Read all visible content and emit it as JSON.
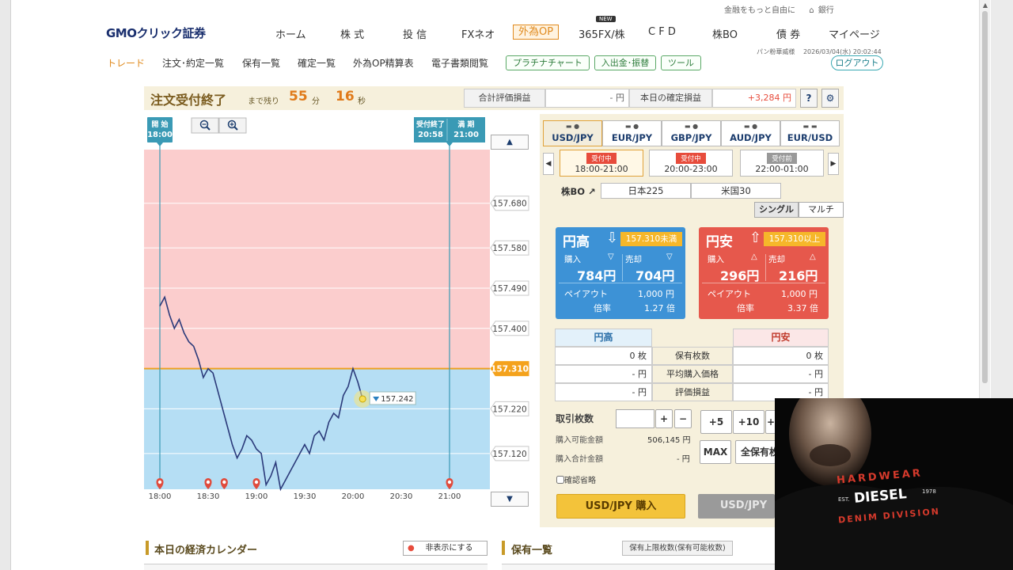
{
  "header": {
    "top_links": [
      "金融をもっと自由に",
      "銀行"
    ],
    "logo_text": "GMOクリック証券",
    "nav": [
      "ホーム",
      "株 式",
      "投 信",
      "FXネオ",
      "外為OP",
      "365FX/株",
      "C F D",
      "株BO",
      "債 券",
      "マイページ"
    ],
    "nav_selected": "外為OP",
    "new_badge": "NEW",
    "user_name": "パン粉華威様",
    "datetime": "2026/03/04(水) 20:02:44",
    "subnav": [
      "トレード",
      "注文･約定一覧",
      "保有一覧",
      "確定一覧",
      "外為OP精算表",
      "電子書類閲覧"
    ],
    "subnav_active": "トレード",
    "tool_buttons": [
      "プラチナチャート",
      "入出金･振替",
      "ツール"
    ],
    "logout": "ログアウト"
  },
  "status": {
    "title": "注文受付終了",
    "remaining_label": "まで残り",
    "minutes": "55",
    "minutes_unit": "分",
    "seconds": "16",
    "seconds_unit": "秒",
    "eval_label": "合計評価損益",
    "eval_value": "- 円",
    "pl_label": "本日の確定損益",
    "pl_value": "+3,284 円",
    "help": "?",
    "settings_icon": "gear-icon"
  },
  "chart": {
    "start_label": "開 始",
    "start_time": "18:00",
    "close_label": "受付終了",
    "close_time": "20:58",
    "expiry_label": "満 期",
    "expiry_time": "21:00",
    "zoom_out": "zoom-out-icon",
    "zoom_in": "zoom-in-icon",
    "current_price": "157.242",
    "strike": "157.310"
  },
  "chart_data": {
    "type": "line",
    "title": "",
    "xlabel": "",
    "ylabel": "",
    "x_ticks": [
      "18:00",
      "18:30",
      "19:00",
      "19:30",
      "20:00",
      "20:30",
      "21:00"
    ],
    "y_ticks": [
      157.68,
      157.58,
      157.49,
      157.4,
      157.31,
      157.22,
      157.12
    ],
    "ylim": [
      157.04,
      157.8
    ],
    "strike": 157.31,
    "current": 157.242,
    "event_markers": [
      "18:00",
      "18:30",
      "18:40",
      "19:00",
      "21:00"
    ],
    "series": [
      {
        "values": [
          [
            "18:00",
            157.45
          ],
          [
            "18:03",
            157.47
          ],
          [
            "18:06",
            157.43
          ],
          [
            "18:09",
            157.4
          ],
          [
            "18:12",
            157.42
          ],
          [
            "18:15",
            157.39
          ],
          [
            "18:18",
            157.37
          ],
          [
            "18:21",
            157.36
          ],
          [
            "18:24",
            157.33
          ],
          [
            "18:27",
            157.29
          ],
          [
            "18:30",
            157.31
          ],
          [
            "18:33",
            157.3
          ],
          [
            "18:36",
            157.26
          ],
          [
            "18:39",
            157.22
          ],
          [
            "18:42",
            157.18
          ],
          [
            "18:45",
            157.14
          ],
          [
            "18:48",
            157.11
          ],
          [
            "18:51",
            157.13
          ],
          [
            "18:54",
            157.16
          ],
          [
            "18:57",
            157.15
          ],
          [
            "19:00",
            157.13
          ],
          [
            "19:03",
            157.12
          ],
          [
            "19:06",
            157.05
          ],
          [
            "19:09",
            157.07
          ],
          [
            "19:12",
            157.1
          ],
          [
            "19:15",
            157.04
          ],
          [
            "19:18",
            157.06
          ],
          [
            "19:21",
            157.08
          ],
          [
            "19:24",
            157.1
          ],
          [
            "19:27",
            157.12
          ],
          [
            "19:30",
            157.14
          ],
          [
            "19:33",
            157.12
          ],
          [
            "19:36",
            157.16
          ],
          [
            "19:39",
            157.17
          ],
          [
            "19:42",
            157.15
          ],
          [
            "19:45",
            157.19
          ],
          [
            "19:48",
            157.21
          ],
          [
            "19:51",
            157.2
          ],
          [
            "19:54",
            157.25
          ],
          [
            "19:57",
            157.27
          ],
          [
            "20:00",
            157.31
          ],
          [
            "20:03",
            157.28
          ],
          [
            "20:06",
            157.242
          ]
        ]
      }
    ]
  },
  "trade": {
    "pairs": [
      "USD/JPY",
      "EUR/JPY",
      "GBP/JPY",
      "AUD/JPY",
      "EUR/USD"
    ],
    "pair_selected": "USD/JPY",
    "slots": [
      {
        "status": "受付中",
        "time": "18:00-21:00",
        "color": "#e74c3c"
      },
      {
        "status": "受付中",
        "time": "20:00-23:00",
        "color": "#e74c3c"
      },
      {
        "status": "受付前",
        "time": "22:00-01:00",
        "color": "#999999"
      }
    ],
    "stock_bo_label": "株BO",
    "markets": [
      "日本225",
      "米国30"
    ],
    "modes": [
      "シングル",
      "マルチ"
    ],
    "mode_selected": "シングル",
    "high": {
      "title": "円高",
      "threshold": "157.310未満",
      "buy_label": "購入",
      "sell_label": "売却",
      "buy": "784円",
      "sell": "704円",
      "payout_label": "ペイアウト",
      "payout": "1,000 円",
      "ratio_label": "倍率",
      "ratio": "1.27 倍",
      "color": "#3d92d6"
    },
    "low": {
      "title": "円安",
      "threshold": "157.310以上",
      "buy_label": "購入",
      "sell_label": "売却",
      "buy": "296円",
      "sell": "216円",
      "payout_label": "ペイアウト",
      "payout": "1,000 円",
      "ratio_label": "倍率",
      "ratio": "3.37 倍",
      "color": "#e6584c"
    },
    "hold_table": {
      "headers": [
        "円高",
        "円安"
      ],
      "rows": [
        {
          "left": "0 枚",
          "label": "保有枚数",
          "right": "0 枚"
        },
        {
          "left": "- 円",
          "label": "平均購入価格",
          "right": "- 円"
        },
        {
          "left": "- 円",
          "label": "評価損益",
          "right": "- 円"
        }
      ]
    },
    "qty_label": "取引枚数",
    "qty_value": "",
    "plus": "+",
    "minus": "−",
    "quick": [
      "+5",
      "+10",
      "+"
    ],
    "available_label": "購入可能金額",
    "available": "506,145 円",
    "total_label": "購入合計金額",
    "total": "- 円",
    "max": "MAX",
    "all_hold": "全保有枚",
    "confirm_skip": "確認省略",
    "buy_button": "USD/JPY 購入",
    "buy_button2": "USD/JPY"
  },
  "bottom": {
    "calendar": "本日の経済カレンダー",
    "hide": "非表示にする",
    "holdings": "保有一覧",
    "holdings_limit": "保有上限枚数(保有可能枚数)"
  },
  "webcam": {
    "shirt_line1": "HARDWEAR",
    "shirt_brand": "DIESEL",
    "shirt_est": "EST.",
    "shirt_year": "1978",
    "shirt_line2": "DENIM DIVISION"
  }
}
